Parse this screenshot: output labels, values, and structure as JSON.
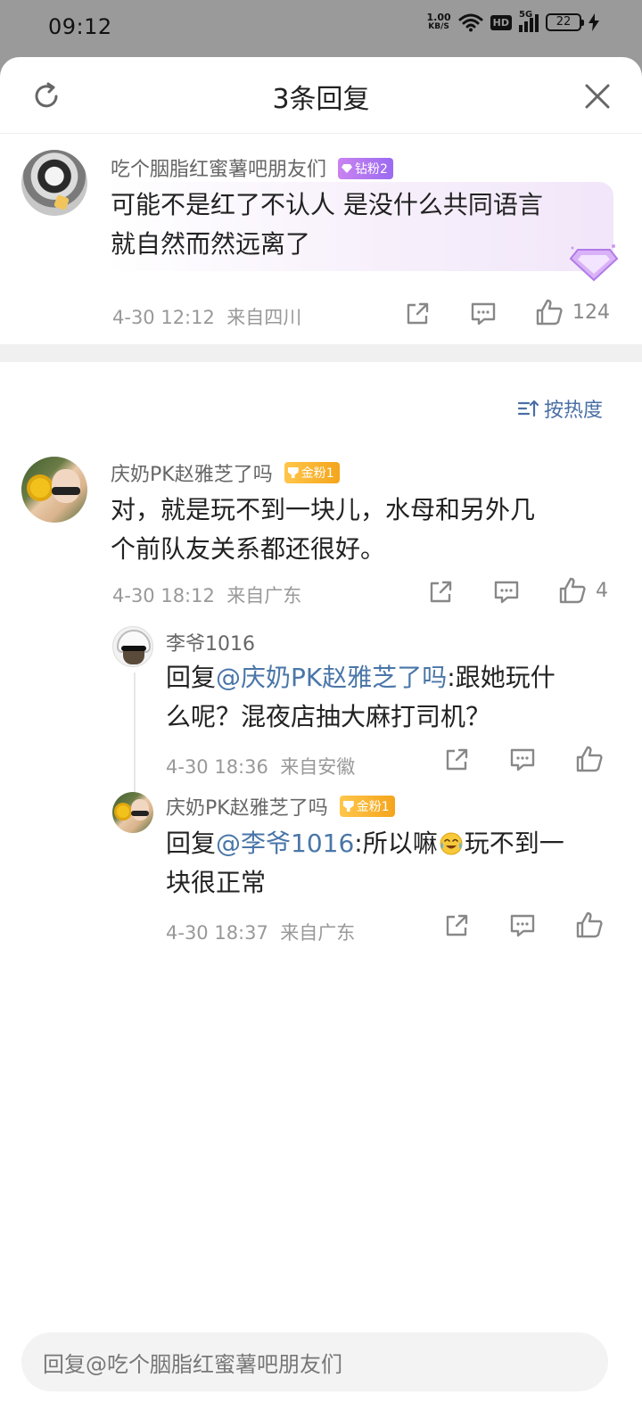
{
  "status_bar": {
    "time": "09:12",
    "speed_value": "1.00",
    "speed_unit": "KB/S",
    "hd": "HD",
    "network": "5G",
    "battery": "22"
  },
  "header": {
    "title": "3条回复",
    "refresh_icon": "refresh-icon",
    "close_icon": "close-icon"
  },
  "main_comment": {
    "username": "吃个胭脂红蜜薯吧朋友们",
    "badge": "钻粉2",
    "text_line1": "可能不是红了不认人 是没什么共同语言",
    "text_line2": "就自然而然远离了",
    "date": "4-30 12:12",
    "location": "来自四川",
    "likes": "124"
  },
  "sort": {
    "label": "按热度"
  },
  "comments": [
    {
      "username": "庆奶PK赵雅芝了吗",
      "badge": "金粉1",
      "text_line1": "对，就是玩不到一块儿，水母和另外几",
      "text_line2": "个前队友关系都还很好。",
      "date": "4-30 18:12",
      "location": "来自广东",
      "likes": "4"
    },
    {
      "username": "李爷1016",
      "reply_prefix": "回复",
      "mention": "@庆奶PK赵雅芝了吗",
      "text_line1": ":跟她玩什",
      "text_line2": "么呢？混夜店抽大麻打司机？",
      "date": "4-30 18:36",
      "location": "来自安徽"
    },
    {
      "username": "庆奶PK赵雅芝了吗",
      "badge": "金粉1",
      "reply_prefix": "回复",
      "mention": "@李爷1016",
      "text_line1": ":所以嘛",
      "text_line1_b": "玩不到一",
      "text_line2": "块很正常",
      "date": "4-30 18:37",
      "location": "来自广东"
    }
  ],
  "reply_bar": {
    "placeholder": "回复@吃个胭脂红蜜薯吧朋友们"
  },
  "colors": {
    "accent_link": "#4a76a8",
    "gold_badge": "#f4a51c",
    "purple_badge": "#9b6bf2"
  }
}
